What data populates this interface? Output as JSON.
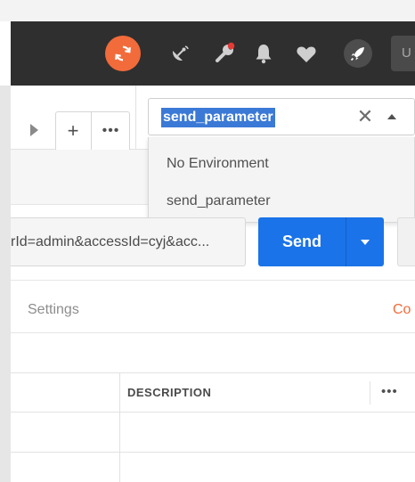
{
  "colors": {
    "header_bg": "#2f2f2f",
    "accent_orange": "#f26b3a",
    "send_blue": "#1a73e8",
    "selection_blue": "#3b79d6",
    "notification_dot": "#e53935"
  },
  "header": {
    "icons": [
      "sync-icon",
      "satellite-icon",
      "wrench-icon",
      "bell-icon",
      "heart-icon",
      "rocket-icon"
    ],
    "upgrade_label": "U"
  },
  "tabs": {
    "new_tab_label": "+",
    "more_label": "•••"
  },
  "environment": {
    "selected": "send_parameter",
    "clear_label": "✕",
    "options": [
      {
        "label": "No Environment"
      },
      {
        "label": "send_parameter"
      }
    ]
  },
  "request": {
    "url_value": "rId=admin&accessId=cyj&acc...",
    "send_label": "Send"
  },
  "request_tabs": {
    "settings_label": "Settings",
    "cookies_label": "Co"
  },
  "params_table": {
    "description_header": "DESCRIPTION",
    "more_label": "•••"
  }
}
